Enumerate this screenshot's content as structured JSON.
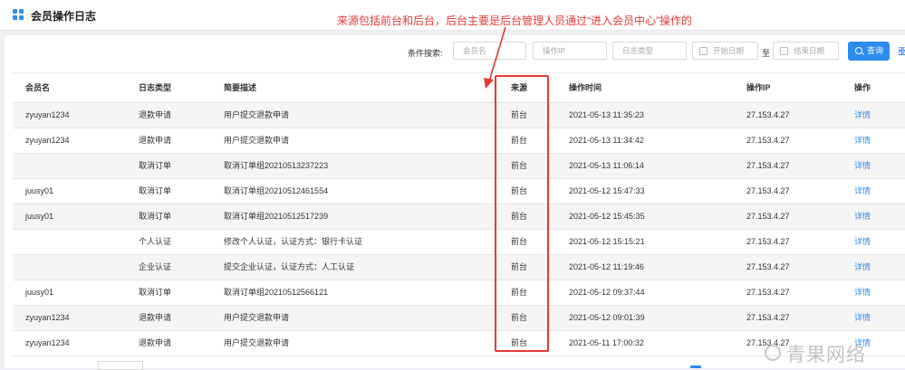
{
  "header": {
    "title": "会员操作日志",
    "annotation": "来源包括前台和后台，后台主要是后台管理人员通过“进入会员中心”操作的"
  },
  "filters": {
    "label": "条件搜索:",
    "member_name_placeholder": "会员名",
    "ip_placeholder": "操作IP",
    "log_type_placeholder": "日志类型",
    "start_date_placeholder": "开始日期",
    "to_label": "至",
    "end_date_placeholder": "结束日期",
    "search_label": "查询"
  },
  "table": {
    "columns": [
      "会员名",
      "日志类型",
      "简要描述",
      "来源",
      "操作时间",
      "操作IP",
      "操作"
    ],
    "rows": [
      {
        "member": "zyuyan1234",
        "type": "退款申请",
        "desc": "用户提交退款申请",
        "source": "前台",
        "time": "2021-05-13 11:35:23",
        "ip": "27.153.4.27",
        "action": "详情"
      },
      {
        "member": "zyuyan1234",
        "type": "退款申请",
        "desc": "用户提交退款申请",
        "source": "前台",
        "time": "2021-05-13 11:34:42",
        "ip": "27.153.4.27",
        "action": "详情"
      },
      {
        "member": "",
        "type": "取消订单",
        "desc": "取消订单组20210513237223",
        "source": "前台",
        "time": "2021-05-13 11:06:14",
        "ip": "27.153.4.27",
        "action": "详情"
      },
      {
        "member": "juusy01",
        "type": "取消订单",
        "desc": "取消订单组20210512461554",
        "source": "前台",
        "time": "2021-05-12 15:47:33",
        "ip": "27.153.4.27",
        "action": "详情"
      },
      {
        "member": "juusy01",
        "type": "取消订单",
        "desc": "取消订单组20210512517239",
        "source": "前台",
        "time": "2021-05-12 15:45:35",
        "ip": "27.153.4.27",
        "action": "详情"
      },
      {
        "member": "",
        "type": "个人认证",
        "desc": "修改个人认证，认证方式：银行卡认证",
        "source": "前台",
        "time": "2021-05-12 15:15:21",
        "ip": "27.153.4.27",
        "action": "详情"
      },
      {
        "member": "",
        "type": "企业认证",
        "desc": "提交企业认证，认证方式：人工认证",
        "source": "前台",
        "time": "2021-05-12 11:19:46",
        "ip": "27.153.4.27",
        "action": "详情"
      },
      {
        "member": "juusy01",
        "type": "取消订单",
        "desc": "取消订单组20210512566121",
        "source": "前台",
        "time": "2021-05-12 09:37:44",
        "ip": "27.153.4.27",
        "action": "详情"
      },
      {
        "member": "zyuyan1234",
        "type": "退款申请",
        "desc": "用户提交退款申请",
        "source": "前台",
        "time": "2021-05-12 09:01:39",
        "ip": "27.153.4.27",
        "action": "详情"
      },
      {
        "member": "zyuyan1234",
        "type": "退款申请",
        "desc": "用户提交退款申请",
        "source": "前台",
        "time": "2021-05-11 17:00:32",
        "ip": "27.153.4.27",
        "action": "详情"
      }
    ]
  },
  "watermark": {
    "text": "青果网络"
  },
  "colors": {
    "accent": "#2d8cf0",
    "annotation": "#e53935"
  },
  "icons": {
    "app": "grid-apps-icon",
    "search": "search-icon",
    "calendar": "calendar-icon",
    "columns": "grid-icon"
  }
}
